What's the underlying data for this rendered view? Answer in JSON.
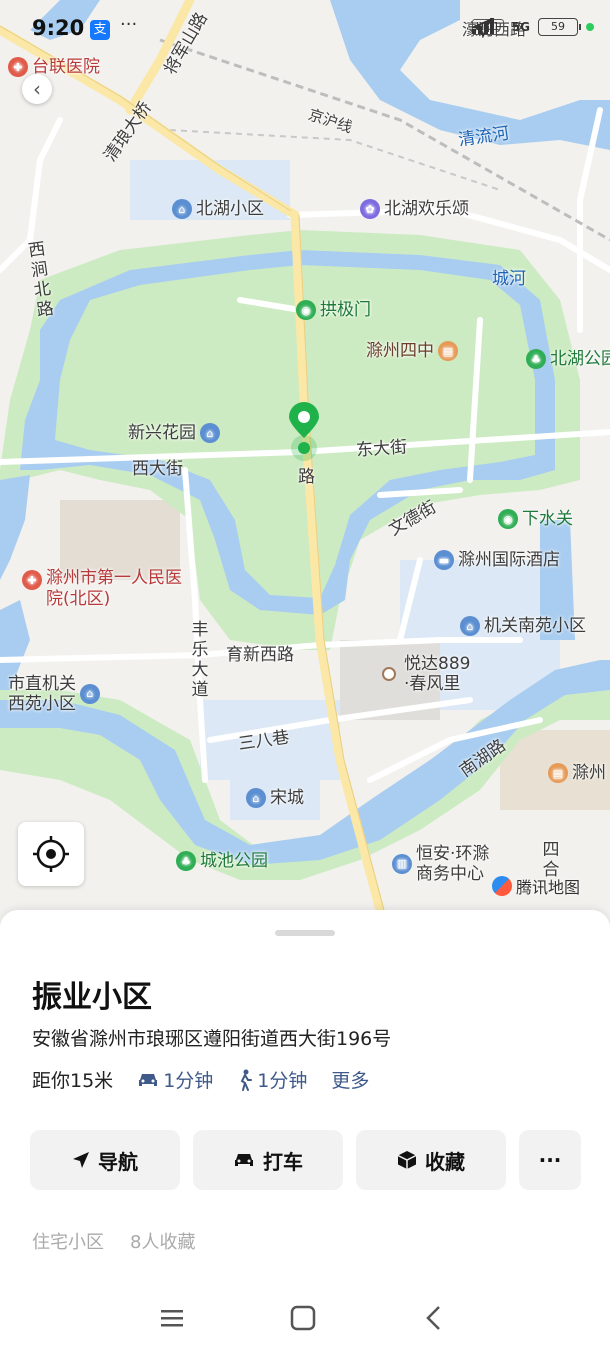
{
  "status_bar": {
    "time": "9:20",
    "alipay_glyph": "支",
    "more_dots": "···",
    "hd_label": "HD1",
    "network": "5G",
    "battery": "59"
  },
  "map": {
    "labels": {
      "tailian_hospital": "台联医院",
      "jiangjunshan_road": "将军山路",
      "qinglang_bridge": "清琅大桥",
      "jinghu_line": "京沪线",
      "qingliu_river": "清流河",
      "haohe_west_road": "濠河西路",
      "beihu_community": "北湖小区",
      "beihu_joy": "北湖欢乐颂",
      "xijian_north_road": "西涧北路",
      "chenghe": "城河",
      "gongjimen": "拱极门",
      "chuzhou_no4_middle": "滁州四中",
      "beihu_park": "北湖公园",
      "xinxing_garden": "新兴花园",
      "dongda_street": "东大街",
      "xida_street": "西大街",
      "road_under_pin": "路",
      "xiashuiguan": "下水关",
      "wende_street": "文德街",
      "chuzhou_intl_hotel": "滁州国际酒店",
      "first_hospital": "滁州市第一人民医院(北区)",
      "jiguan_nanyuan": "机关南苑小区",
      "fengle_avenue": "丰乐大道",
      "yuxin_west_road": "育新西路",
      "yueda889_line1": "悦达889",
      "yueda889_line2": "·春风里",
      "shizhi_jiguan_line1": "市直机关",
      "shizhi_jiguan_line2": "西苑小区",
      "sanba_lane": "三八巷",
      "nanhu_road": "南湖路",
      "chuzhou_edge": "滁州",
      "song_city": "宋城",
      "chengchi_park": "城池公园",
      "hengan_line1": "恒安·环滁",
      "hengan_line2": "商务中心",
      "sihe": "四合",
      "tencent_map": "腾讯地图"
    }
  },
  "place": {
    "name": "振业小区",
    "address": "安徽省滁州市琅琊区遵阳街道西大街196号",
    "distance": "距你15米",
    "drive_time": "1分钟",
    "walk_time": "1分钟",
    "more": "更多",
    "tags": [
      "住宅小区",
      "8人收藏"
    ]
  },
  "actions": {
    "navigate": "导航",
    "taxi": "打车",
    "favorite": "收藏",
    "more": "···"
  },
  "colors": {
    "water": "#a9cdf0",
    "park": "#cdebc2",
    "main_road": "#fbe7a6",
    "pin": "#1fb24a",
    "link": "#3f5a8a"
  }
}
